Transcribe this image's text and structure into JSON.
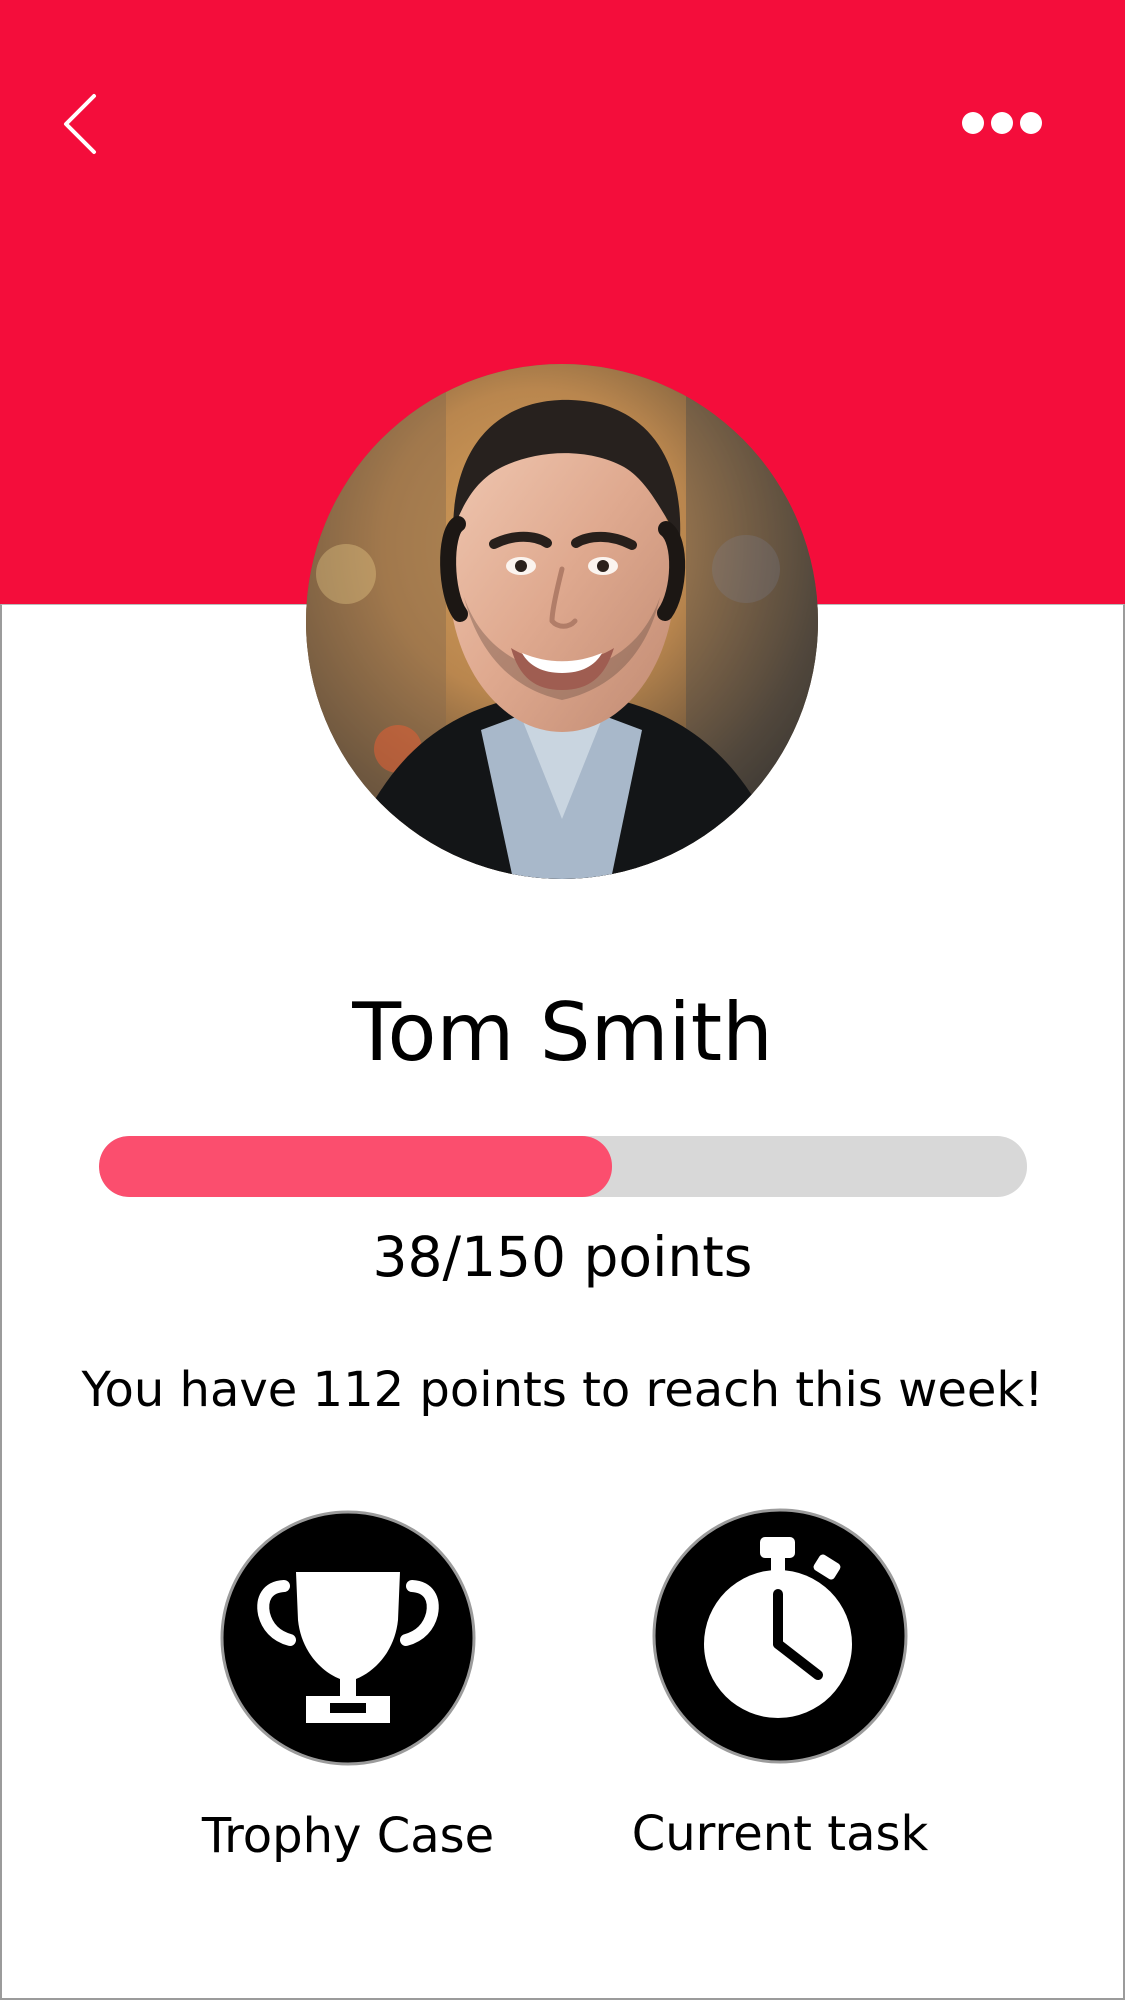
{
  "colors": {
    "header_background": "#f40d3b",
    "progress_fill": "#fb4e6e",
    "progress_track": "#d8d8d8",
    "icon_circle": "#000000",
    "icon_foreground": "#ffffff",
    "page_background": "#ffffff"
  },
  "header": {
    "back_icon": "chevron-left-icon",
    "menu_icon": "more-horizontal-icon"
  },
  "profile": {
    "avatar_icon": "profile-photo",
    "name": "Tom Smith"
  },
  "progress": {
    "current": 38,
    "goal": 150,
    "fraction": 0.553,
    "label": "38/150 points"
  },
  "message": "You have 112 points to reach this week!",
  "actions": [
    {
      "icon": "trophy-icon",
      "label": "Trophy Case"
    },
    {
      "icon": "stopwatch-icon",
      "label": "Current task"
    }
  ]
}
